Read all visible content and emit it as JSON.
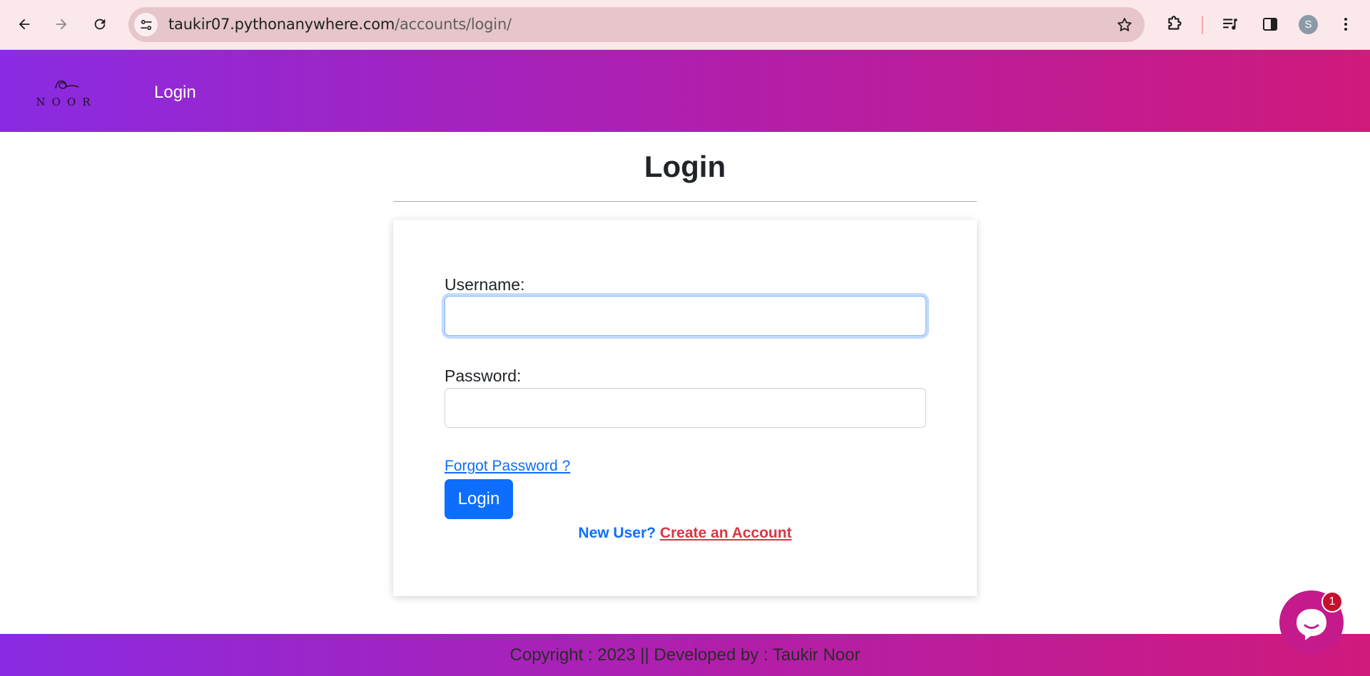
{
  "browser": {
    "url_host": "taukir07.pythonanywhere.com",
    "url_path": "/accounts/login/",
    "profile_initial": "S"
  },
  "header": {
    "logo_text": "NOOR",
    "nav_login": "Login"
  },
  "main": {
    "title": "Login",
    "username_label": "Username:",
    "username_value": "",
    "password_label": "Password:",
    "password_value": "",
    "forgot_password": "Forgot Password ?",
    "login_button": "Login",
    "new_user": "New User?",
    "create_account": "Create an Account"
  },
  "footer": {
    "copyright": "Copyright : 2023 || Developed by : Taukir Noor"
  },
  "chat": {
    "badge_count": "1"
  },
  "colors": {
    "gradient_start": "#8a2be2",
    "gradient_end": "#d01a7c",
    "primary": "#0d6efd",
    "danger": "#dc3545"
  }
}
